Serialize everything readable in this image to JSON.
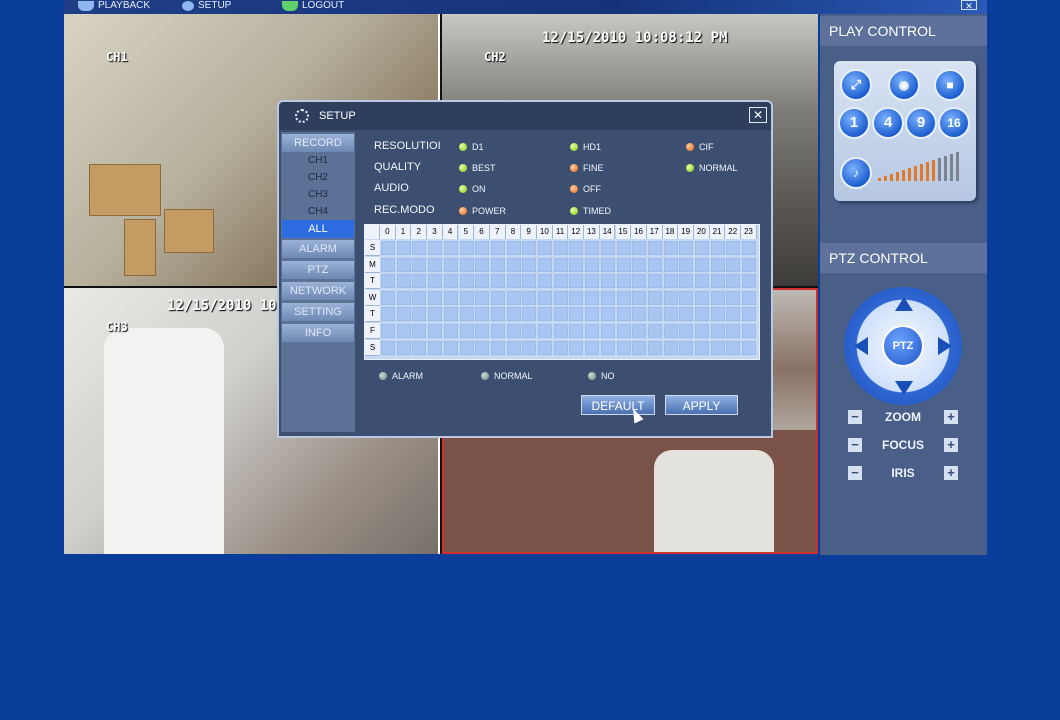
{
  "topbar": {
    "playback": "PLAYBACK",
    "setup": "SETUP",
    "logout": "LOGOUT"
  },
  "cameras": [
    {
      "label": "CH1",
      "timestamp": ""
    },
    {
      "label": "CH2",
      "timestamp": "12/15/2010 10:08:12 PM"
    },
    {
      "label": "CH3",
      "timestamp": "12/15/2010 10"
    },
    {
      "label": "",
      "timestamp": ""
    }
  ],
  "right_panel": {
    "play_control_title": "PLAY CONTROL",
    "ptz_control_title": "PTZ CONTROL",
    "split_buttons": [
      "1",
      "4",
      "9",
      "16"
    ],
    "ptz_center": "PTZ",
    "controls": [
      "ZOOM",
      "FOCUS",
      "IRIS"
    ],
    "minus": "−",
    "plus": "+"
  },
  "dialog": {
    "title": "SETUP",
    "close": "✕",
    "menu": [
      {
        "label": "RECORD",
        "selected": false
      },
      {
        "label": "ALARM",
        "selected": false
      },
      {
        "label": "PTZ",
        "selected": false
      },
      {
        "label": "NETWORK",
        "selected": false
      },
      {
        "label": "SETTING",
        "selected": false
      },
      {
        "label": "INFO",
        "selected": false
      }
    ],
    "record_sub": [
      "CH1",
      "CH2",
      "CH3",
      "CH4",
      "ALL"
    ],
    "record_sub_selected": "ALL",
    "settings": {
      "resolution": {
        "label": "RESOLUTIOI",
        "options": [
          {
            "text": "D1",
            "color": "green"
          },
          {
            "text": "HD1",
            "color": "green"
          },
          {
            "text": "CIF",
            "color": "orange"
          }
        ]
      },
      "quality": {
        "label": "QUALITY",
        "options": [
          {
            "text": "BEST",
            "color": "green"
          },
          {
            "text": "FINE",
            "color": "orange"
          },
          {
            "text": "NORMAL",
            "color": "green"
          }
        ]
      },
      "audio": {
        "label": "AUDIO",
        "options": [
          {
            "text": "ON",
            "color": "green"
          },
          {
            "text": "OFF",
            "color": "orange"
          }
        ]
      },
      "rec_mode": {
        "label": "REC.MODO",
        "options": [
          {
            "text": "POWER",
            "color": "orange"
          },
          {
            "text": "TIMED",
            "color": "green"
          }
        ]
      }
    },
    "schedule": {
      "hours": [
        "0",
        "1",
        "2",
        "3",
        "4",
        "5",
        "6",
        "7",
        "8",
        "9",
        "10",
        "11",
        "12",
        "13",
        "14",
        "15",
        "16",
        "17",
        "18",
        "19",
        "20",
        "21",
        "22",
        "23"
      ],
      "days": [
        "S",
        "M",
        "T",
        "W",
        "T",
        "F",
        "S"
      ]
    },
    "legend": [
      "ALARM",
      "NORMAL",
      "NO"
    ],
    "buttons": {
      "default": "DEFAULT",
      "apply": "APPLY"
    }
  },
  "colors": {
    "background": "#0a3d9a",
    "panel": "#4a5f87",
    "dialog": "#3c4f70",
    "accent": "#2d6be0"
  }
}
